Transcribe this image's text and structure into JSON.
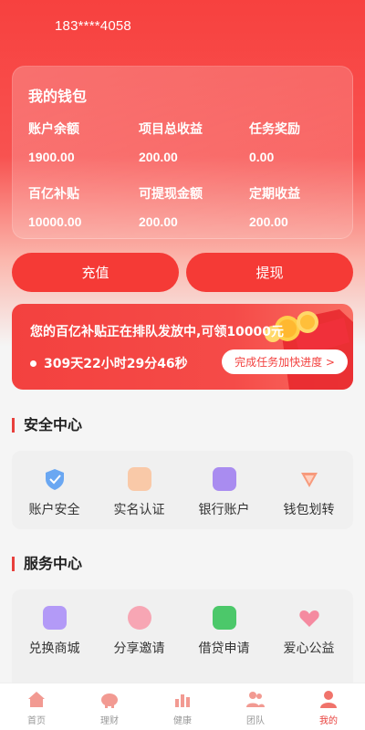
{
  "header": {
    "phone": "183****4058"
  },
  "wallet": {
    "title": "我的钱包",
    "stats": [
      {
        "label": "账户余额",
        "value": "1900.00"
      },
      {
        "label": "项目总收益",
        "value": "200.00"
      },
      {
        "label": "任务奖励",
        "value": "0.00"
      },
      {
        "label": "百亿补贴",
        "value": "10000.00"
      },
      {
        "label": "可提现金额",
        "value": "200.00"
      },
      {
        "label": "定期收益",
        "value": "200.00"
      }
    ]
  },
  "actions": {
    "recharge": "充值",
    "withdraw": "提现"
  },
  "banner": {
    "text": "您的百亿补贴正在排队发放中,可领10000元",
    "timer": "309天22小时29分46秒",
    "cta": "完成任务加快进度 >"
  },
  "security": {
    "title": "安全中心",
    "items": [
      {
        "label": "账户安全",
        "icon": "shield-icon"
      },
      {
        "label": "实名认证",
        "icon": "id-card-icon"
      },
      {
        "label": "银行账户",
        "icon": "bank-card-icon"
      },
      {
        "label": "钱包划转",
        "icon": "transfer-icon"
      }
    ]
  },
  "services": {
    "title": "服务中心",
    "items": [
      {
        "label": "兑换商城",
        "icon": "mall-icon"
      },
      {
        "label": "分享邀请",
        "icon": "share-icon"
      },
      {
        "label": "借贷申请",
        "icon": "loan-icon"
      },
      {
        "label": "爱心公益",
        "icon": "charity-icon"
      }
    ]
  },
  "tabbar": {
    "items": [
      {
        "label": "首页",
        "icon": "home-icon"
      },
      {
        "label": "理财",
        "icon": "piggy-bank-icon"
      },
      {
        "label": "健康",
        "icon": "health-icon"
      },
      {
        "label": "团队",
        "icon": "team-icon"
      },
      {
        "label": "我的",
        "icon": "profile-icon"
      }
    ],
    "active": "我的"
  },
  "colors": {
    "accent": "#f3413f",
    "background": "#f5f5f5"
  }
}
